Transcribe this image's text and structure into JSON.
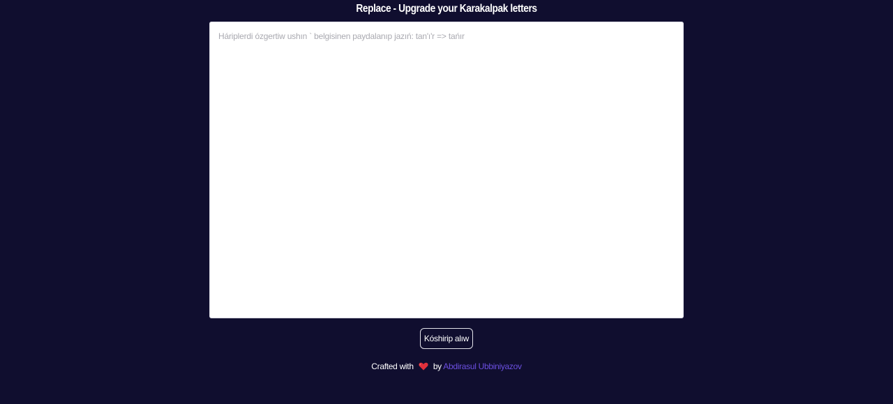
{
  "header": {
    "title": "Replace - Upgrade your Karakalpak letters"
  },
  "editor": {
    "placeholder": "Háriplerdi ózgertiw ushın ` belgisinen paydalanıp jazıń: tan'ı'r => tańır",
    "value": ""
  },
  "actions": {
    "copy_label": "Kóshirip alıw"
  },
  "footer": {
    "crafted_prefix": "Crafted with",
    "heart_icon": "heart-icon",
    "by_label": "by",
    "author_name": "Abdirasul Ubbiniyazov"
  },
  "colors": {
    "background": "#100e2f",
    "panel": "#ffffff",
    "link": "#6b4fe0",
    "heart": "#e0303c"
  }
}
